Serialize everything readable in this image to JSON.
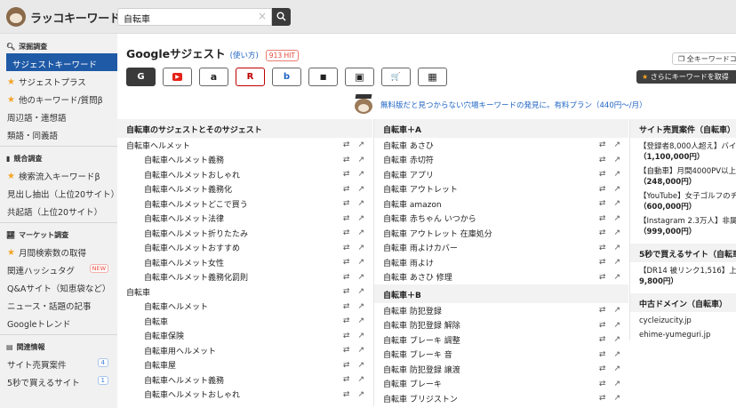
{
  "header": {
    "logo_text": "ラッコキーワード",
    "search_value": "自転車"
  },
  "sidebar": {
    "sections": [
      {
        "title": "深掘調査",
        "items": [
          "サジェストキーワード",
          "サジェストプラス",
          "他のキーワード/質問β",
          "周辺語・連想語",
          "類語・同義語"
        ]
      },
      {
        "title": "競合調査",
        "items": [
          "検索流入キーワードβ",
          "見出し抽出（上位20サイト）",
          "共起語（上位20サイト）"
        ]
      },
      {
        "title": "マーケット調査",
        "items": [
          "月間検索数の取得",
          "関連ハッシュタグ",
          "Q&Aサイト（知恵袋など）",
          "ニュース・話題の記事",
          "Googleトレンド"
        ]
      },
      {
        "title": "関連情報",
        "items": [
          "サイト売買案件",
          "5秒で買えるサイト"
        ]
      }
    ],
    "badge_new": "NEW",
    "badge_sites": "4",
    "badge_5sec": "1"
  },
  "main": {
    "title": "Googleサジェスト",
    "howto": "(使い方)",
    "hit": "913 HIT",
    "all_keywords_button": "全キーワードコピー",
    "more_keywords_button": "さらにキーワードを取得",
    "engines": [
      "G",
      "▶",
      "a",
      "R",
      "b",
      "■",
      "▣",
      "🛒",
      "▦"
    ],
    "promo_text": "無料版だと見つからない穴場キーワードの発見に。有料プラン（440円〜/月）",
    "col1": {
      "header": "自転車のサジェストとそのサジェスト",
      "rows": [
        {
          "text": "自転車ヘルメット",
          "sub": false
        },
        {
          "text": "自転車ヘルメット義務",
          "sub": true
        },
        {
          "text": "自転車ヘルメットおしゃれ",
          "sub": true
        },
        {
          "text": "自転車ヘルメット義務化",
          "sub": true
        },
        {
          "text": "自転車ヘルメットどこで買う",
          "sub": true
        },
        {
          "text": "自転車ヘルメット法律",
          "sub": true
        },
        {
          "text": "自転車ヘルメット折りたたみ",
          "sub": true
        },
        {
          "text": "自転車ヘルメットおすすめ",
          "sub": true
        },
        {
          "text": "自転車ヘルメット女性",
          "sub": true
        },
        {
          "text": "自転車ヘルメット義務化罰則",
          "sub": true
        },
        {
          "text": "自転車",
          "sub": false
        },
        {
          "text": "自転車ヘルメット",
          "sub": true
        },
        {
          "text": "自転車",
          "sub": true
        },
        {
          "text": "自転車保険",
          "sub": true
        },
        {
          "text": "自転車用ヘルメット",
          "sub": true
        },
        {
          "text": "自転車屋",
          "sub": true
        },
        {
          "text": "自転車ヘルメット義務",
          "sub": true
        },
        {
          "text": "自転車ヘルメットおしゃれ",
          "sub": true
        }
      ]
    },
    "col2": {
      "header_a": "自転車＋A",
      "rows_a": [
        "自転車 あさひ",
        "自転車 赤切符",
        "自転車 アプリ",
        "自転車 アウトレット",
        "自転車 amazon",
        "自転車 赤ちゃん いつから",
        "自転車 アウトレット 在庫処分",
        "自転車 雨よけカバー",
        "自転車 雨よけ",
        "自転車 あさひ 修理"
      ],
      "header_b": "自転車＋B",
      "rows_b": [
        "自転車 防犯登録",
        "自転車 防犯登録 解除",
        "自転車 ブレーキ 調整",
        "自転車 ブレーキ 音",
        "自転車 防犯登録 譲渡",
        "自転車 ブレーキ",
        "自転車 ブリジストン"
      ]
    },
    "col3": {
      "header1": "サイト売買案件（自転車）",
      "items1": [
        {
          "text": "【登録者8,000人超え】バイク",
          "price": "（1,100,000円）"
        },
        {
          "text": "【自動車】月間4000PV以上の",
          "price": "（248,000円）"
        },
        {
          "text": "【YouTube】女子ゴルフのチ",
          "price": "（600,000円）"
        },
        {
          "text": "【Instagram 2.3万人】非属人",
          "price": "（999,000円）"
        }
      ],
      "header2": "5秒で買えるサイト（自転車）",
      "items2": [
        {
          "text": "【DR14 被リンク1,516】上流",
          "price": "9,800円）"
        }
      ],
      "header3": "中古ドメイン（自転車）",
      "domains": [
        "cycleizucity.jp",
        "ehime-yumeguri.jp"
      ]
    }
  }
}
